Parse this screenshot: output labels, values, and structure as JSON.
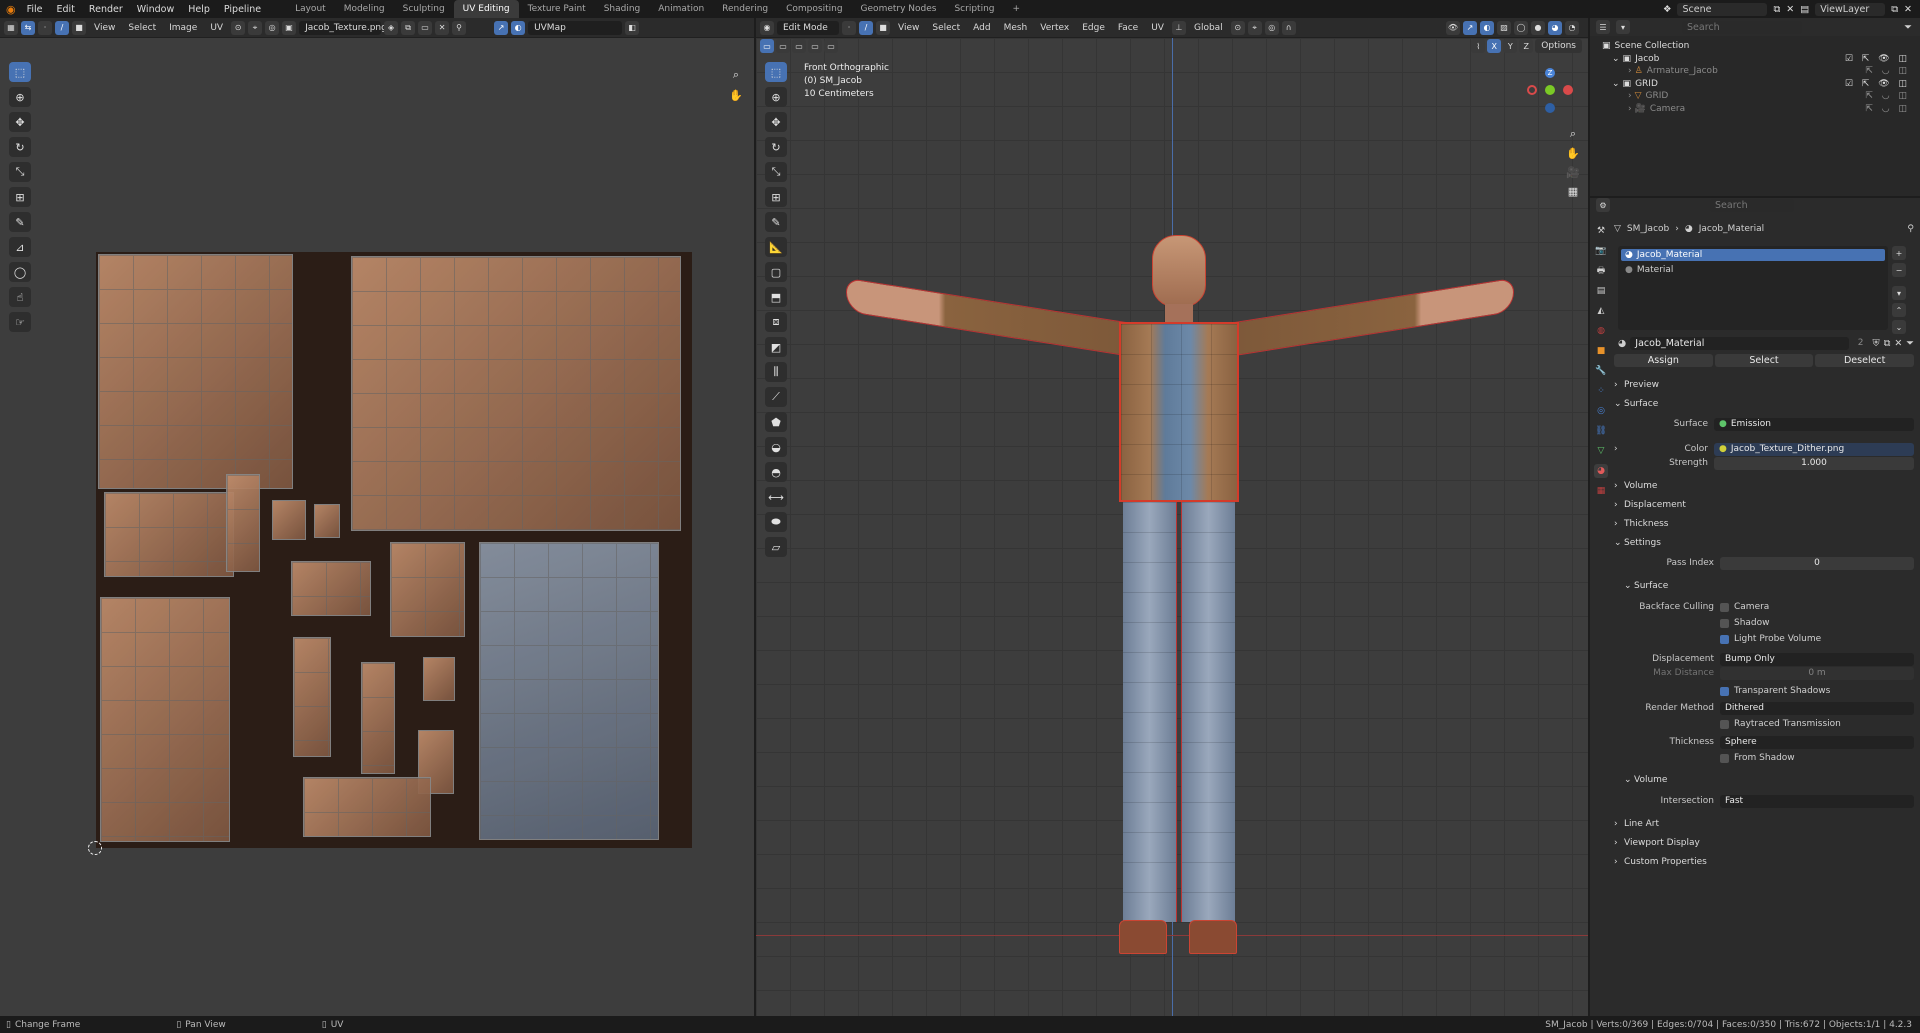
{
  "app": {
    "menus": [
      "File",
      "Edit",
      "Render",
      "Window",
      "Help",
      "Pipeline"
    ],
    "workspaces": [
      "Layout",
      "Modeling",
      "Sculpting",
      "UV Editing",
      "Texture Paint",
      "Shading",
      "Animation",
      "Rendering",
      "Compositing",
      "Geometry Nodes",
      "Scripting"
    ],
    "active_workspace": "UV Editing",
    "scene": "Scene",
    "view_layer": "ViewLayer"
  },
  "uv_editor": {
    "menus": [
      "View",
      "Select",
      "Image",
      "UV"
    ],
    "image_name": "Jacob_Texture.png",
    "uv_map": "UVMap"
  },
  "viewport": {
    "mode": "Edit Mode",
    "menus": [
      "View",
      "Select",
      "Add",
      "Mesh",
      "Vertex",
      "Edge",
      "Face",
      "UV"
    ],
    "orientation": "Global",
    "options_label": "Options",
    "info_view": "Front Orthographic",
    "info_object": "(0) SM_Jacob",
    "info_scale": "10 Centimeters",
    "axes": [
      "X",
      "Y",
      "Z"
    ]
  },
  "outliner": {
    "search_placeholder": "Search",
    "title": "Scene Collection",
    "items": [
      {
        "label": "Jacob"
      },
      {
        "label": "Armature_Jacob"
      },
      {
        "label": "GRID"
      },
      {
        "label": "GRID"
      },
      {
        "label": "Camera"
      }
    ]
  },
  "properties": {
    "search_placeholder": "Search",
    "breadcrumb_object": "SM_Jacob",
    "breadcrumb_material": "Jacob_Material",
    "slots": [
      "Jacob_Material",
      "Material"
    ],
    "material_name": "Jacob_Material",
    "user_count": "2",
    "buttons": [
      "Assign",
      "Select",
      "Deselect"
    ],
    "panels": {
      "preview": "Preview",
      "surface": "Surface",
      "volume": "Volume",
      "displacement": "Displacement",
      "thickness": "Thickness",
      "settings": "Settings",
      "settings_surface": "Surface",
      "settings_volume": "Volume",
      "line_art": "Line Art",
      "viewport_display": "Viewport Display",
      "custom_properties": "Custom Properties"
    },
    "surface_label": "Surface",
    "surface_value": "Emission",
    "color_label": "Color",
    "color_value": "Jacob_Texture_Dither.png",
    "strength_label": "Strength",
    "strength_value": "1.000",
    "pass_index_label": "Pass Index",
    "pass_index_value": "0",
    "backface_label": "Backface Culling",
    "backface_camera": "Camera",
    "backface_shadow": "Shadow",
    "light_probe": "Light Probe Volume",
    "displacement_label": "Displacement",
    "displacement_value": "Bump Only",
    "max_distance_label": "Max Distance",
    "max_distance_value": "0 m",
    "transparent_shadows": "Transparent Shadows",
    "render_method_label": "Render Method",
    "render_method_value": "Dithered",
    "raytraced": "Raytraced Transmission",
    "thickness_label": "Thickness",
    "thickness_value": "Sphere",
    "from_shadow": "From Shadow",
    "intersection_label": "Intersection",
    "intersection_value": "Fast"
  },
  "status": {
    "left1": "Change Frame",
    "left2": "Pan View",
    "left3": "UV",
    "stats": "SM_Jacob | Verts:0/369 | Edges:0/704 | Faces:0/350 | Tris:672 | Objects:1/1 | 4.2.3"
  },
  "colors": {
    "accent": "#4772b3",
    "selection_edge": "#d43b2a"
  }
}
